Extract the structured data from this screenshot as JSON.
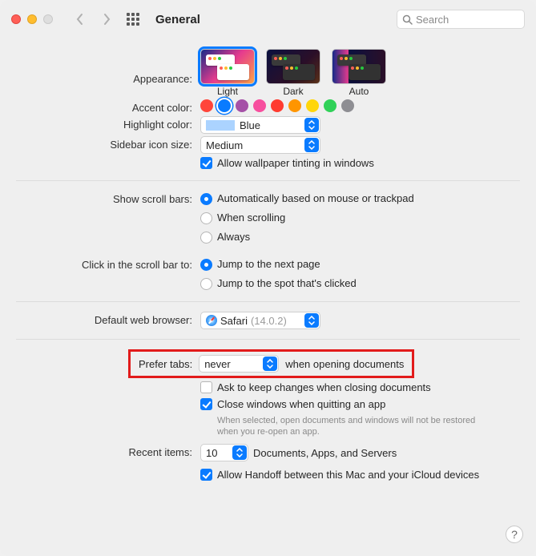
{
  "titlebar": {
    "title": "General",
    "search_placeholder": "Search"
  },
  "appearance": {
    "label": "Appearance:",
    "options": {
      "light": "Light",
      "dark": "Dark",
      "auto": "Auto"
    },
    "selected": "light"
  },
  "accent": {
    "label": "Accent color:",
    "colors": [
      "#ff453a",
      "#0a7bff",
      "#a550a7",
      "#f74f9e",
      "#ff3b30",
      "#ff9500",
      "#ffd60a",
      "#30d158",
      "#8e8e93"
    ],
    "selected_index": 1
  },
  "highlight": {
    "label": "Highlight color:",
    "value": "Blue",
    "swatch": "#abd3ff"
  },
  "sidebar_size": {
    "label": "Sidebar icon size:",
    "value": "Medium"
  },
  "wallpaper_tint": {
    "label": "Allow wallpaper tinting in windows",
    "checked": true
  },
  "scrollbars": {
    "label": "Show scroll bars:",
    "options": [
      "Automatically based on mouse or trackpad",
      "When scrolling",
      "Always"
    ],
    "selected_index": 0
  },
  "click_scroll": {
    "label": "Click in the scroll bar to:",
    "options": [
      "Jump to the next page",
      "Jump to the spot that's clicked"
    ],
    "selected_index": 0
  },
  "browser": {
    "label": "Default web browser:",
    "name": "Safari",
    "version": "(14.0.2)"
  },
  "tabs": {
    "label": "Prefer tabs:",
    "value": "never",
    "suffix": "when opening documents"
  },
  "ask_keep": {
    "label": "Ask to keep changes when closing documents",
    "checked": false
  },
  "close_windows": {
    "label": "Close windows when quitting an app",
    "checked": true,
    "hint": "When selected, open documents and windows will not be restored when you re-open an app."
  },
  "recent": {
    "label": "Recent items:",
    "value": "10",
    "suffix": "Documents, Apps, and Servers"
  },
  "handoff": {
    "label": "Allow Handoff between this Mac and your iCloud devices",
    "checked": true
  },
  "help": "?"
}
